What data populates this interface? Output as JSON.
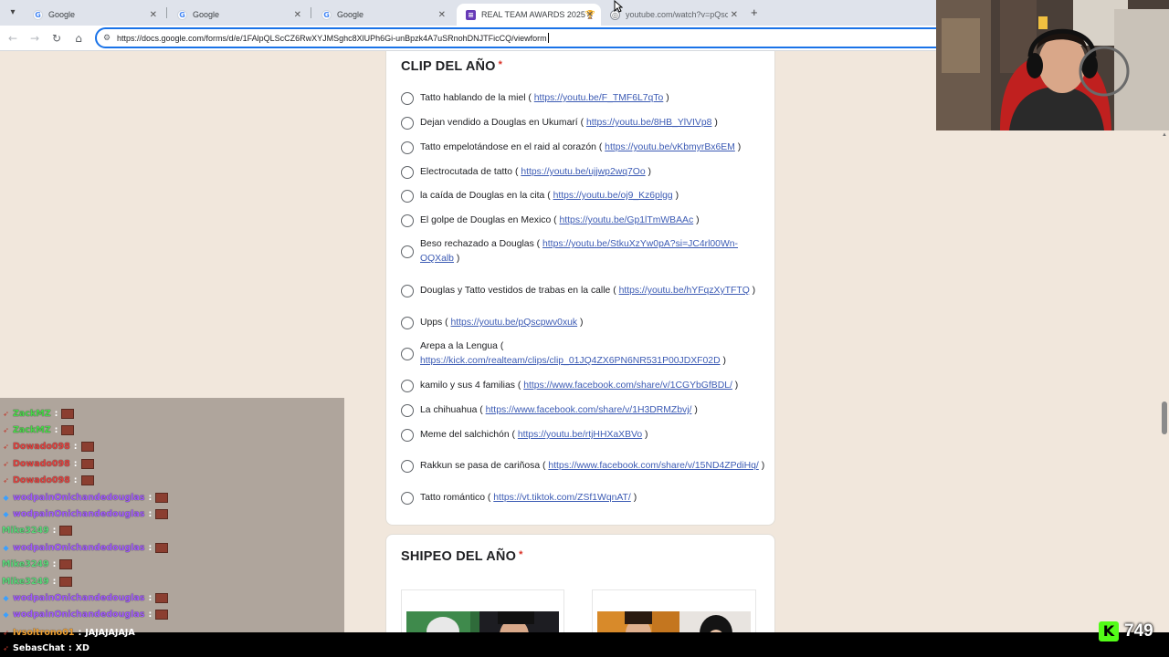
{
  "browser": {
    "tabs": [
      {
        "title": "Google",
        "icon": "google-icon"
      },
      {
        "title": "Google",
        "icon": "google-icon"
      },
      {
        "title": "Google",
        "icon": "google-icon"
      },
      {
        "title": "REAL TEAM AWARDS 2025🏆",
        "icon": "google-forms-icon",
        "active": true
      },
      {
        "title": "youtube.com/watch?v=pQscpw",
        "icon": "globe-icon"
      }
    ],
    "url": "https://docs.google.com/forms/d/e/1FAlpQLScCZ6RwXYJMSghc8XlUPh6Gi-unBpzk4A7uSRnohDNJTFicCQ/viewform"
  },
  "form": {
    "question1": {
      "title": "CLIP DEL AÑO",
      "required_mark": "*",
      "options": [
        {
          "text": "Tatto hablando de la miel (",
          "link": "https://youtu.be/F_TMF6L7qTo",
          "end": ")"
        },
        {
          "text": "Dejan vendido a Douglas en Ukumarí (",
          "link": "https://youtu.be/8HB_YlVIVp8",
          "end": ")"
        },
        {
          "text": "Tatto empelotándose en el raid al corazón (",
          "link": "https://youtu.be/vKbmyrBx6EM",
          "end": ")"
        },
        {
          "text": "Electrocutada de tatto (",
          "link": "https://youtu.be/ujjwp2wq7Oo",
          "end": ")"
        },
        {
          "text": "la caída de Douglas  en la cita (",
          "link": "https://youtu.be/oj9_Kz6plgg",
          "end": ")"
        },
        {
          "text": "El golpe de Douglas en Mexico (",
          "link": "https://youtu.be/Gp1lTmWBAAc",
          "end": ")"
        },
        {
          "text": "Beso rechazado a Douglas (",
          "link": "https://youtu.be/StkuXzYw0pA?si=JC4rl00Wn-OQXalb",
          "end": ")"
        },
        {
          "text": "Douglas y Tatto vestidos de trabas en la calle (",
          "link": "https://youtu.be/hYFqzXyTFTQ",
          "end": ")"
        },
        {
          "text": "Upps (",
          "link": "https://youtu.be/pQscpwv0xuk",
          "end": ")"
        },
        {
          "text": "Arepa a la Lengua (",
          "link": "https://kick.com/realteam/clips/clip_01JQ4ZX6PN6NR531P00JDXF02D",
          "end": ")"
        },
        {
          "text": "kamilo y sus 4 familias (",
          "link": "https://www.facebook.com/share/v/1CGYbGfBDL/",
          "end": ")"
        },
        {
          "text": "La chihuahua (",
          "link": "https://www.facebook.com/share/v/1H3DRMZbvj/",
          "end": ")"
        },
        {
          "text": "Meme del salchichón (",
          "link": "https://youtu.be/rtjHHXaXBVo",
          "end": ")"
        },
        {
          "text": "Rakkun se pasa de cariñosa (",
          "link": "https://www.facebook.com/share/v/15ND4ZPdiHq/",
          "end": ")"
        },
        {
          "text": "Tatto romántico (",
          "link": "https://vt.tiktok.com/ZSf1WqnAT/",
          "end": ")"
        }
      ]
    },
    "question2": {
      "title": "SHIPEO DEL AÑO",
      "required_mark": "*"
    }
  },
  "chat": {
    "messages": [
      {
        "user": "ZackMZ",
        "color": "#4ad84a",
        "badge": "kick"
      },
      {
        "user": "ZackMZ",
        "color": "#4ad84a",
        "badge": "kick"
      },
      {
        "user": "Dowado098",
        "color": "#e0413e",
        "badge": "kick"
      },
      {
        "user": "Dowado098",
        "color": "#e0413e",
        "badge": "kick"
      },
      {
        "user": "Dowado098",
        "color": "#e0413e",
        "badge": "kick"
      },
      {
        "user": "wodpainOnichandedouglas",
        "color": "#a35cff",
        "badge": "sub"
      },
      {
        "user": "wodpainOnichandedouglas",
        "color": "#a35cff",
        "badge": "sub"
      },
      {
        "user": "Mike3249",
        "color": "#5ad67a",
        "badge": "none"
      },
      {
        "user": "wodpainOnichandedouglas",
        "color": "#a35cff",
        "badge": "sub"
      },
      {
        "user": "Mike3249",
        "color": "#5ad67a",
        "badge": "none"
      },
      {
        "user": "Mike3249",
        "color": "#5ad67a",
        "badge": "none"
      },
      {
        "user": "wodpainOnichandedouglas",
        "color": "#a35cff",
        "badge": "sub"
      },
      {
        "user": "wodpainOnichandedouglas",
        "color": "#a35cff",
        "badge": "sub"
      }
    ],
    "overlay_messages": [
      {
        "user": "Ivsoltrono01",
        "text": "JAJAJAJAJA",
        "color": "#f0a030"
      },
      {
        "user": "SebasChat",
        "text": "XD",
        "color": "#ffffff"
      }
    ],
    "separator": ":"
  },
  "stream": {
    "viewer_count": "749",
    "platform_logo": "K",
    "accent": "#53fc18"
  }
}
